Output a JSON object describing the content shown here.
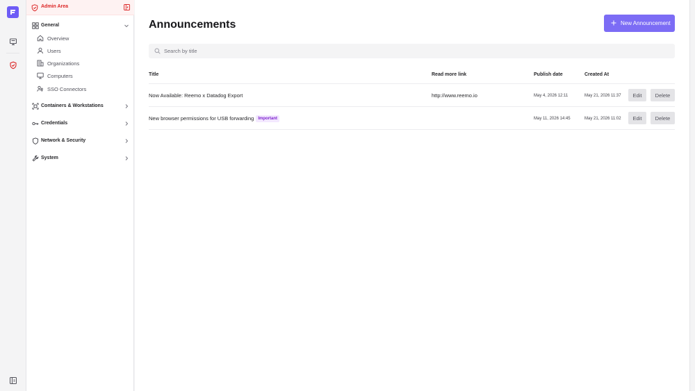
{
  "sidebar": {
    "admin_label": "Admin Area",
    "general": {
      "label": "General",
      "items": [
        {
          "label": "Overview",
          "icon": "home-icon"
        },
        {
          "label": "Users",
          "icon": "user-icon"
        },
        {
          "label": "Organizations",
          "icon": "building-icon"
        },
        {
          "label": "Computers",
          "icon": "monitor-icon"
        },
        {
          "label": "SSO Connectors",
          "icon": "users-key-icon"
        }
      ]
    },
    "sections": [
      {
        "label": "Containers & Workstations",
        "icon": "containers-icon"
      },
      {
        "label": "Credentials",
        "icon": "key-icon"
      },
      {
        "label": "Network & Security",
        "icon": "shield-icon"
      },
      {
        "label": "System",
        "icon": "wrench-icon"
      }
    ]
  },
  "main": {
    "title": "Announcements",
    "new_button": "New Announcement",
    "search": {
      "placeholder": "Search by title",
      "value": ""
    },
    "columns": [
      "Title",
      "Read more link",
      "Publish date",
      "Created At"
    ],
    "rows": [
      {
        "title": "Now Available: Reemo x Datadog Export",
        "badge": "",
        "link": "http://www.reemo.io",
        "publish": "May 4, 2026 12:11",
        "created": "May 21, 2026 11:37",
        "edit": "Edit",
        "delete": "Delete"
      },
      {
        "title": "New browser permissions for USB forwarding",
        "badge": "Important",
        "link": "",
        "publish": "May 11, 2026 14:45",
        "created": "May 21, 2026 11:02",
        "edit": "Edit",
        "delete": "Delete"
      }
    ]
  },
  "colors": {
    "accent": "#7c6cf5",
    "admin_red": "#dc2626",
    "badge_bg": "#f3e8ff",
    "badge_text": "#7e22ce"
  }
}
